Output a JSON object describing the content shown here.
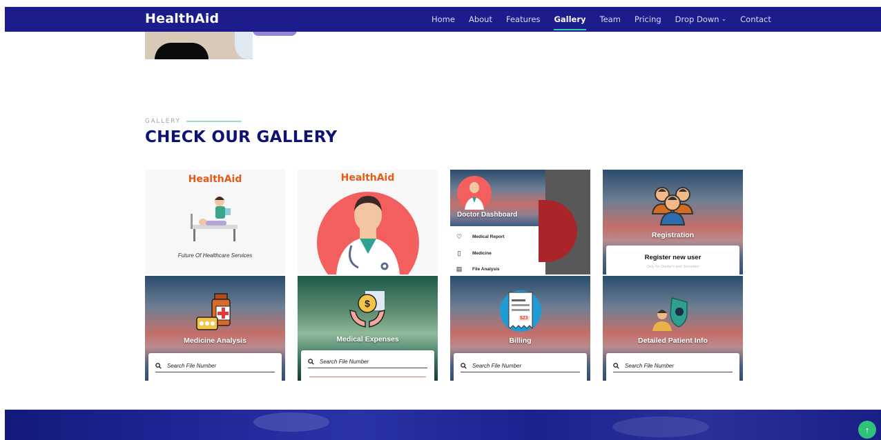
{
  "nav": {
    "brand": "HealthAid",
    "links": [
      {
        "label": "Home"
      },
      {
        "label": "About"
      },
      {
        "label": "Features"
      },
      {
        "label": "Gallery",
        "active": true
      },
      {
        "label": "Team"
      },
      {
        "label": "Pricing"
      },
      {
        "label": "Drop Down",
        "has_dropdown": true
      },
      {
        "label": "Contact"
      }
    ]
  },
  "section": {
    "label": "GALLERY",
    "title": "CHECK OUR GALLERY"
  },
  "gallery": {
    "tile1": {
      "logo": "HealthAid",
      "caption": "Future Of Healthcare Services"
    },
    "tile2": {
      "logo": "HealthAid"
    },
    "tile3": {
      "title": "Doctor Dashboard",
      "items": [
        "Medical Report",
        "Medicine",
        "File Analysis"
      ]
    },
    "tile4": {
      "title": "Registration",
      "card_title": "Register new user",
      "card_sub": "Only for Doctor's and Secretary"
    },
    "tile5": {
      "title": "Medicine Analysis",
      "search": "Search File Number"
    },
    "tile6": {
      "title": "Medical Expenses",
      "search": "Search File Number"
    },
    "tile7": {
      "title": "Billing",
      "search": "Search File Number",
      "bill_amount": "$23"
    },
    "tile8": {
      "title": "Detailed Patient Info",
      "search": "Search File Number"
    }
  },
  "colors": {
    "nav_bg": "#1c1c8c",
    "accent": "#2fd2a8",
    "title": "#0e1275",
    "logo_orange": "#e55a18",
    "back_to_top": "#2fc27a"
  },
  "icons": {
    "back_to_top": "arrow-up-icon",
    "dropdown": "chevron-down-icon",
    "search": "search-icon"
  }
}
